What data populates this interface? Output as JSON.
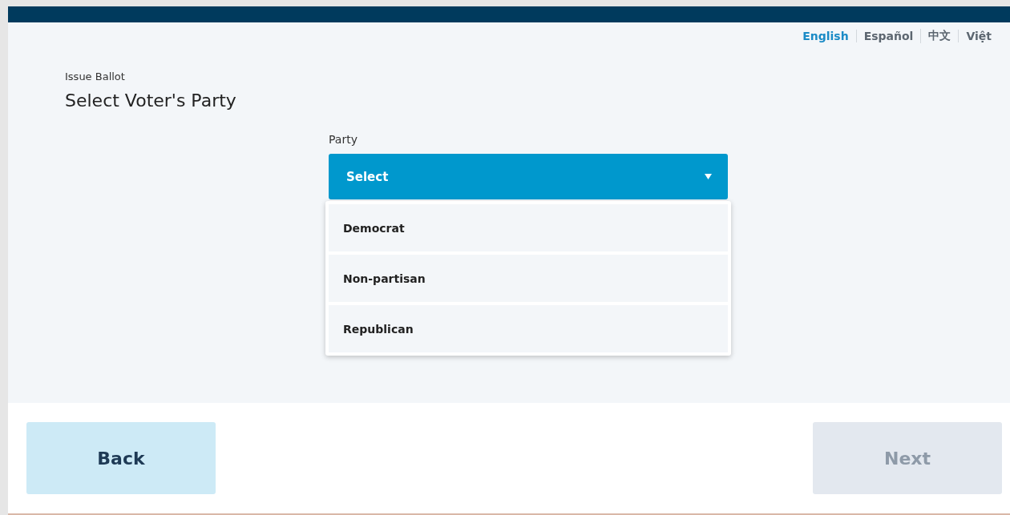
{
  "languages": [
    {
      "label": "English",
      "selected": true
    },
    {
      "label": "Español",
      "selected": false
    },
    {
      "label": "中文",
      "selected": false
    },
    {
      "label": "Việt",
      "selected": false
    }
  ],
  "breadcrumb": "Issue Ballot",
  "title": "Select Voter's Party",
  "party_field": {
    "label": "Party",
    "value": "Select",
    "expanded": true,
    "options": [
      {
        "label": "Democrat"
      },
      {
        "label": "Non-partisan"
      },
      {
        "label": "Republican"
      }
    ]
  },
  "buttons": [
    {
      "label": "Back",
      "disabled": false
    },
    {
      "label": "Next",
      "disabled": true
    }
  ]
}
